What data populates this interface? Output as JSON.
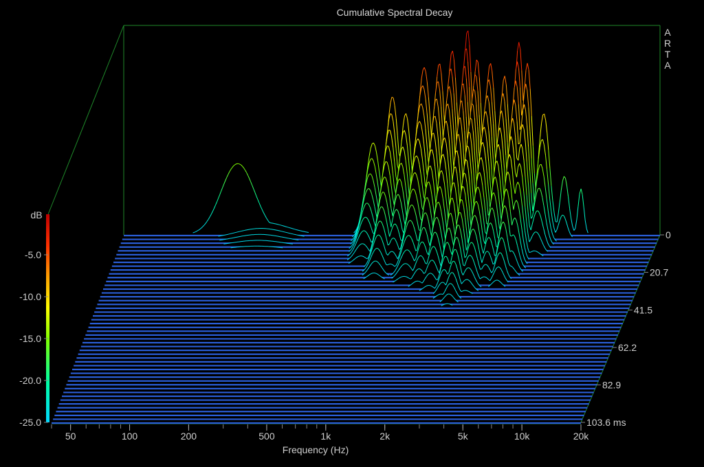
{
  "chart_data": {
    "type": "area",
    "title": "Cumulative Spectral Decay",
    "watermark": "ARTA",
    "xlabel": "Frequency (Hz)",
    "zlabel": "dB",
    "x_scale": "log",
    "xlim": [
      40,
      20000
    ],
    "x_ticks": [
      {
        "value": 50,
        "label": "50"
      },
      {
        "value": 100,
        "label": "100"
      },
      {
        "value": 200,
        "label": "200"
      },
      {
        "value": 500,
        "label": "500"
      },
      {
        "value": 1000,
        "label": "1k"
      },
      {
        "value": 2000,
        "label": "2k"
      },
      {
        "value": 5000,
        "label": "5k"
      },
      {
        "value": 10000,
        "label": "10k"
      },
      {
        "value": 20000,
        "label": "20k"
      }
    ],
    "zlim": [
      -25,
      0
    ],
    "z_ticks": [
      {
        "value": -5,
        "label": "-5.0"
      },
      {
        "value": -10,
        "label": "-10.0"
      },
      {
        "value": -15,
        "label": "-15.0"
      },
      {
        "value": -20,
        "label": "-20.0"
      },
      {
        "value": -25,
        "label": "-25.0"
      }
    ],
    "time_unit": "ms",
    "tlim": [
      0,
      103.6
    ],
    "t_ticks": [
      {
        "value": 0,
        "label": "0"
      },
      {
        "value": 20.7,
        "label": "20.7"
      },
      {
        "value": 41.5,
        "label": "41.5"
      },
      {
        "value": 62.2,
        "label": "62.2"
      },
      {
        "value": 82.9,
        "label": "82.9"
      },
      {
        "value": 103.6,
        "label": "103.6 ms"
      }
    ],
    "slice_count": 50,
    "colormap": [
      "#00d8ff",
      "#00ffa0",
      "#80ff00",
      "#ffff00",
      "#ffa000",
      "#ff3000",
      "#c00000"
    ],
    "floor_color": "#2a5ed8",
    "frame_color": "#1f8a2a",
    "peaks": [
      {
        "freq": 150,
        "level": -16.5,
        "width": 0.12,
        "decay_ms": 2
      },
      {
        "freq": 200,
        "level": -23.5,
        "width": 0.18,
        "decay_ms": 14
      },
      {
        "freq": 720,
        "level": -14.0,
        "width": 0.05,
        "decay_ms": 20
      },
      {
        "freq": 900,
        "level": -8.5,
        "width": 0.045,
        "decay_ms": 28
      },
      {
        "freq": 1050,
        "level": -10.5,
        "width": 0.04,
        "decay_ms": 24
      },
      {
        "freq": 1300,
        "level": -5.0,
        "width": 0.05,
        "decay_ms": 30
      },
      {
        "freq": 1550,
        "level": -4.5,
        "width": 0.04,
        "decay_ms": 32
      },
      {
        "freq": 1800,
        "level": -3.0,
        "width": 0.04,
        "decay_ms": 34
      },
      {
        "freq": 2150,
        "level": -0.5,
        "width": 0.035,
        "decay_ms": 38
      },
      {
        "freq": 2400,
        "level": -4.0,
        "width": 0.035,
        "decay_ms": 42
      },
      {
        "freq": 2800,
        "level": -4.5,
        "width": 0.04,
        "decay_ms": 36
      },
      {
        "freq": 3300,
        "level": -6.0,
        "width": 0.035,
        "decay_ms": 30
      },
      {
        "freq": 3900,
        "level": -2.0,
        "width": 0.035,
        "decay_ms": 32
      },
      {
        "freq": 4300,
        "level": -4.5,
        "width": 0.035,
        "decay_ms": 26
      },
      {
        "freq": 5200,
        "level": -10.5,
        "width": 0.04,
        "decay_ms": 14
      },
      {
        "freq": 6600,
        "level": -18.0,
        "width": 0.03,
        "decay_ms": 4
      },
      {
        "freq": 8000,
        "level": -19.5,
        "width": 0.02,
        "decay_ms": 2
      }
    ]
  }
}
